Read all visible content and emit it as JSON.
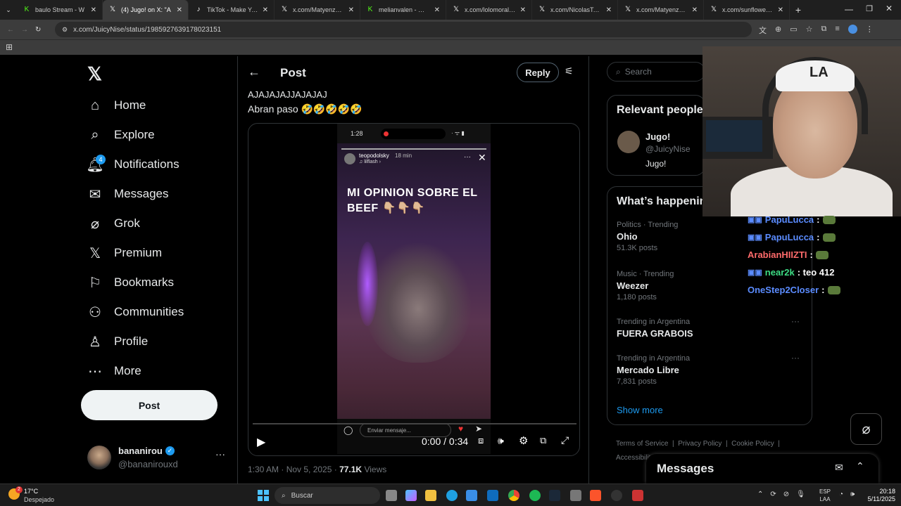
{
  "browser": {
    "tabs": [
      {
        "label": "baulo Stream - W",
        "icon": "kick-icon",
        "color": "#53fc18"
      },
      {
        "label": "(4) Jugo! on X: \"A",
        "icon": "x-icon",
        "color": "#ffffff"
      },
      {
        "label": "TikTok - Make Your D",
        "icon": "tiktok-icon",
        "color": "#ffffff"
      },
      {
        "label": "x.com/Matyenzoo/sta",
        "icon": "x-icon",
        "color": "#ffffff"
      },
      {
        "label": "melianvalen - Watch",
        "icon": "kick-icon",
        "color": "#53fc18"
      },
      {
        "label": "x.com/lolomorales_/s",
        "icon": "x-icon",
        "color": "#ffffff"
      },
      {
        "label": "x.com/NicolasTaps/st",
        "icon": "x-icon",
        "color": "#ffffff"
      },
      {
        "label": "x.com/Matyenzoo/sta",
        "icon": "x-icon",
        "color": "#ffffff"
      },
      {
        "label": "x.com/sunflowerofca",
        "icon": "x-icon",
        "color": "#ffffff"
      }
    ],
    "url": "x.com/JuicyNise/status/1985927639178023151"
  },
  "nav": {
    "items": [
      {
        "label": "Home",
        "icon": "home-icon"
      },
      {
        "label": "Explore",
        "icon": "search-icon"
      },
      {
        "label": "Notifications",
        "icon": "bell-icon",
        "badge": "4"
      },
      {
        "label": "Messages",
        "icon": "envelope-icon"
      },
      {
        "label": "Grok",
        "icon": "grok-icon"
      },
      {
        "label": "Premium",
        "icon": "x-logo-icon"
      },
      {
        "label": "Bookmarks",
        "icon": "bookmark-icon"
      },
      {
        "label": "Communities",
        "icon": "people-icon"
      },
      {
        "label": "Profile",
        "icon": "person-icon"
      },
      {
        "label": "More",
        "icon": "more-circle-icon"
      }
    ],
    "post_button": "Post",
    "account": {
      "name": "bananirou",
      "handle": "@bananirouxd"
    }
  },
  "post": {
    "header": "Post",
    "reply_button": "Reply",
    "text_line1": "AJAJAJAJJAJAJAJ",
    "text_line2": "Abran paso 🤣🤣🤣🤣🤣",
    "video": {
      "story_time": "1:28",
      "story_user": "teopodolsky",
      "story_age": "18 min",
      "story_music": "♫ lilflash ›",
      "overlay_text": "MI OPINION SOBRE EL BEEF 👇🏼👇🏼👇🏼",
      "message_placeholder": "Enviar mensaje...",
      "time": "0:00 / 0:34",
      "progress": 0
    },
    "meta_time": "1:30 AM · Nov 5, 2025 · ",
    "meta_views_count": "77.1K",
    "meta_views_label": " Views"
  },
  "sidebar": {
    "search_placeholder": "Search",
    "relevant_title": "Relevant people",
    "relevant_person": {
      "name": "Jugo!",
      "handle": "@JuicyNise",
      "bio": "Jugo!"
    },
    "happening_title": "What’s happening",
    "trends": [
      {
        "context": "Politics · Trending",
        "name": "Ohio",
        "posts": "51.3K posts"
      },
      {
        "context": "Music · Trending",
        "name": "Weezer",
        "posts": "1,180 posts"
      },
      {
        "context": "Trending in Argentina",
        "name": "FUERA GRABOIS",
        "posts": ""
      },
      {
        "context": "Trending in Argentina",
        "name": "Mercado Libre",
        "posts": "7,831 posts"
      }
    ],
    "show_more": "Show more",
    "footer": [
      "Terms of Service",
      "Privacy Policy",
      "Cookie Policy",
      "Accessibility"
    ],
    "messages_label": "Messages"
  },
  "stream_chat": [
    {
      "user": "PapuLucca",
      "msg": ":",
      "color": "#5b8cff"
    },
    {
      "user": "PapuLucca",
      "msg": ":",
      "color": "#5b8cff"
    },
    {
      "user": "ArabianHIIZTI",
      "msg": ":",
      "color": "#ff6b6b"
    },
    {
      "user": "near2k",
      "msg": ": teo 412",
      "color": "#3ddc84"
    },
    {
      "user": "OneStep2Closer",
      "msg": ":",
      "color": "#5b8cff"
    }
  ],
  "taskbar": {
    "weather_temp": "17°C",
    "weather_desc": "Despejado",
    "search": "Buscar",
    "lang_line1": "ESP",
    "lang_line2": "LAA",
    "time": "20:18",
    "date": "5/11/2025",
    "weather_badge": "2"
  }
}
